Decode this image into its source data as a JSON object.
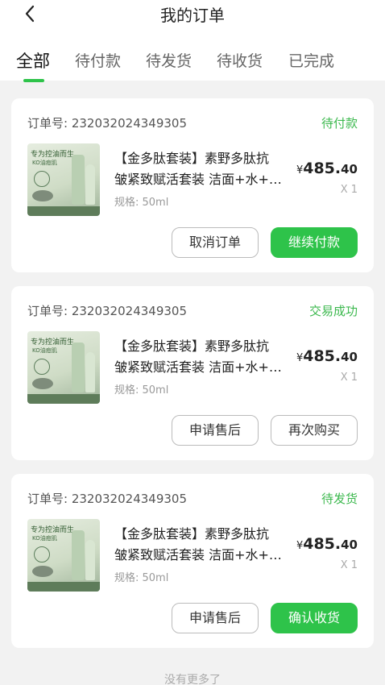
{
  "header": {
    "title": "我的订单"
  },
  "tabs": [
    {
      "label": "全部"
    },
    {
      "label": "待付款"
    },
    {
      "label": "待发货"
    },
    {
      "label": "待收货"
    },
    {
      "label": "已完成"
    }
  ],
  "orders": [
    {
      "order_prefix": "订单号:",
      "order_no": "232032024349305",
      "status": "待付款",
      "product": {
        "name_line1": "【金多肽套装】素野多肽抗",
        "name_line2": "皱紧致赋活套装 洁面+水+…",
        "spec": "规格: 50ml",
        "image_text": "专为控油而生",
        "image_subtext": "KO油痘肌"
      },
      "price_currency": "¥",
      "price_int": "485.",
      "price_dec": "40",
      "qty": "X 1",
      "buttons": [
        {
          "label": "取消订单",
          "style": "outline"
        },
        {
          "label": "继续付款",
          "style": "primary"
        }
      ]
    },
    {
      "order_prefix": "订单号:",
      "order_no": "232032024349305",
      "status": "交易成功",
      "product": {
        "name_line1": "【金多肽套装】素野多肽抗",
        "name_line2": "皱紧致赋活套装 洁面+水+…",
        "spec": "规格: 50ml",
        "image_text": "专为控油而生",
        "image_subtext": "KO油痘肌"
      },
      "price_currency": "¥",
      "price_int": "485.",
      "price_dec": "40",
      "qty": "X 1",
      "buttons": [
        {
          "label": "申请售后",
          "style": "outline"
        },
        {
          "label": "再次购买",
          "style": "outline"
        }
      ]
    },
    {
      "order_prefix": "订单号:",
      "order_no": "232032024349305",
      "status": "待发货",
      "product": {
        "name_line1": "【金多肽套装】素野多肽抗",
        "name_line2": "皱紧致赋活套装 洁面+水+…",
        "spec": "规格: 50ml",
        "image_text": "专为控油而生",
        "image_subtext": "KO油痘肌"
      },
      "price_currency": "¥",
      "price_int": "485.",
      "price_dec": "40",
      "qty": "X 1",
      "buttons": [
        {
          "label": "申请售后",
          "style": "outline"
        },
        {
          "label": "确认收货",
          "style": "primary"
        }
      ]
    }
  ],
  "footer": {
    "note": "没有更多了"
  },
  "colors": {
    "accent": "#2ec34a",
    "status": "#3db94f",
    "background": "#f2f2f2"
  },
  "icons": {
    "back": "chevron-left-icon"
  }
}
